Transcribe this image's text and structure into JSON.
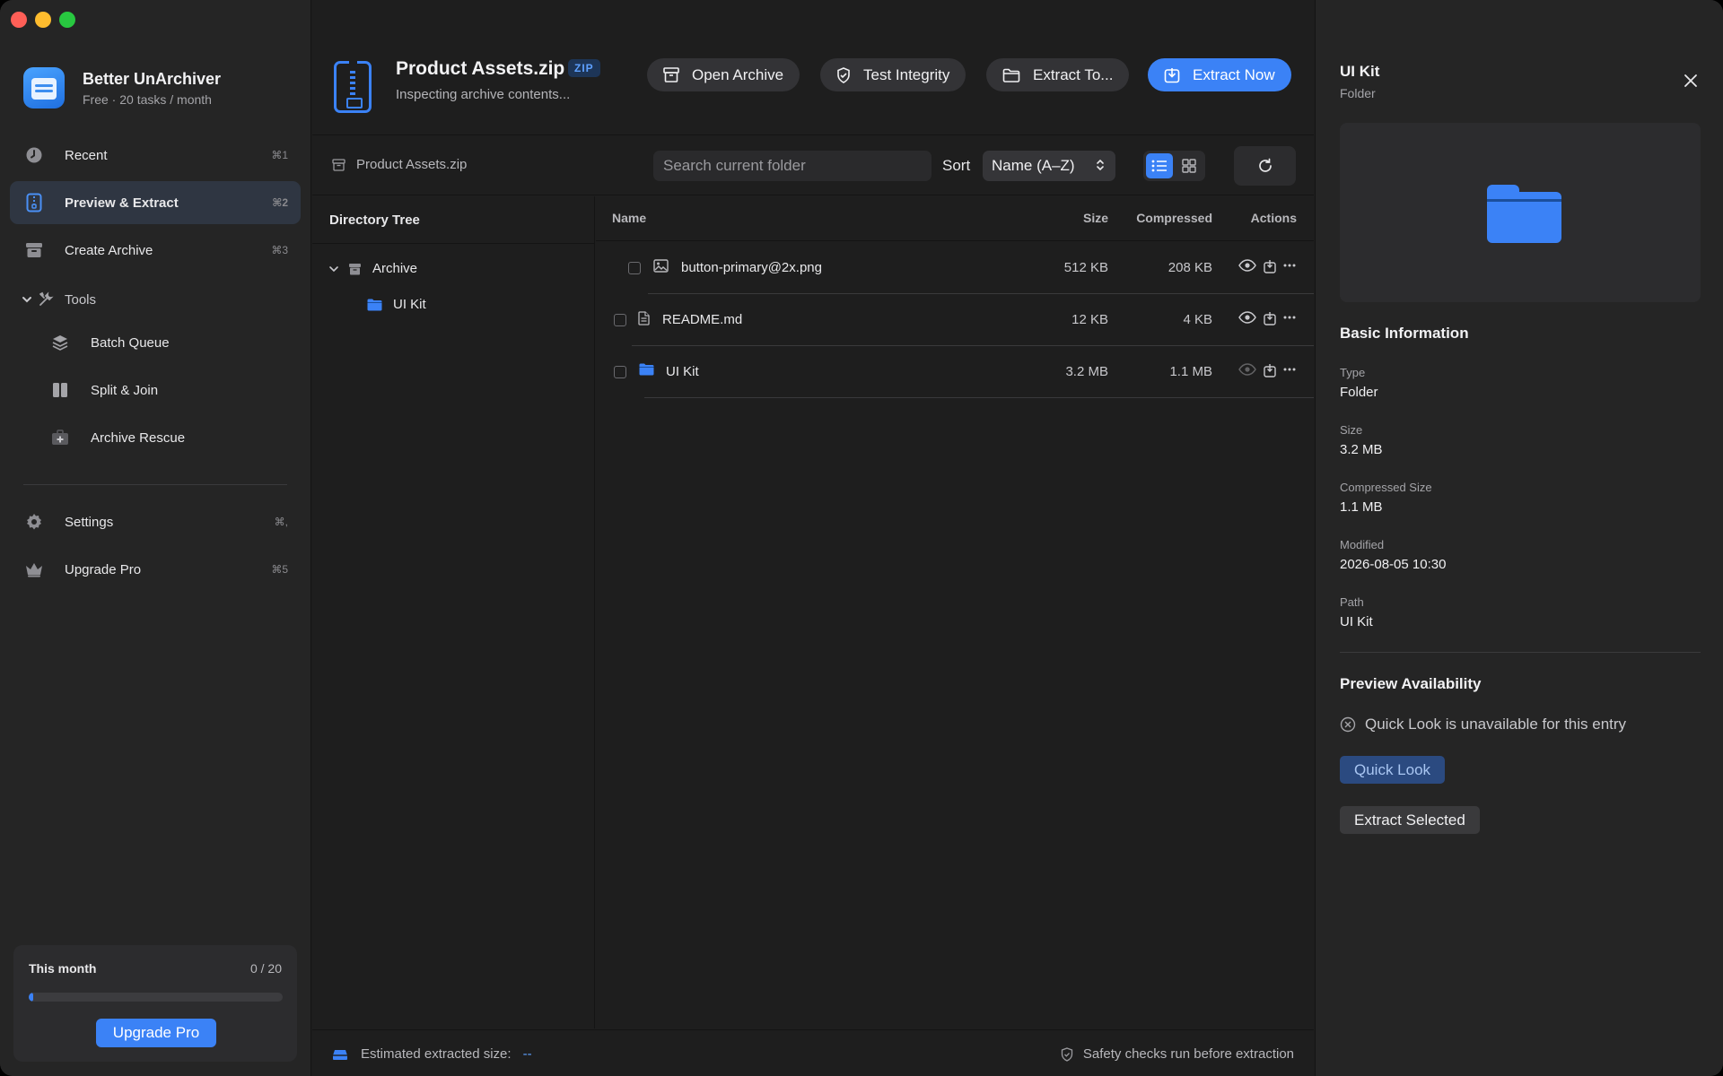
{
  "app": {
    "name": "Better UnArchiver",
    "plan": "Free · 20 tasks / month"
  },
  "sidebar": {
    "items": [
      {
        "label": "Recent",
        "shortcut": "⌘1",
        "icon": "clock-icon"
      },
      {
        "label": "Preview & Extract",
        "shortcut": "⌘2",
        "icon": "zip-file-icon",
        "active": true
      },
      {
        "label": "Create Archive",
        "shortcut": "⌘3",
        "icon": "archive-box-icon"
      }
    ],
    "tools_label": "Tools",
    "tools": [
      {
        "label": "Batch Queue",
        "icon": "layers-icon"
      },
      {
        "label": "Split & Join",
        "icon": "split-icon"
      },
      {
        "label": "Archive Rescue",
        "icon": "rescue-kit-icon"
      }
    ],
    "bottom_items": [
      {
        "label": "Settings",
        "shortcut": "⌘,",
        "icon": "gear-icon"
      },
      {
        "label": "Upgrade Pro",
        "shortcut": "⌘5",
        "icon": "crown-icon"
      }
    ],
    "usage": {
      "title": "This month",
      "count_text": "0 / 20",
      "used": 0,
      "limit": 20,
      "button": "Upgrade Pro"
    }
  },
  "header": {
    "file_name": "Product Assets.zip",
    "badge": "ZIP",
    "status": "Inspecting archive contents...",
    "buttons": {
      "open": "Open Archive",
      "test": "Test Integrity",
      "extract_to": "Extract To...",
      "extract_now": "Extract Now"
    }
  },
  "toolbar": {
    "breadcrumb": "Product Assets.zip",
    "search_placeholder": "Search current folder",
    "sort_label": "Sort",
    "sort_value": "Name (A–Z)",
    "view_mode": "list"
  },
  "tree": {
    "title": "Directory Tree",
    "root": "Archive",
    "children": [
      "UI Kit"
    ]
  },
  "table": {
    "headers": {
      "name": "Name",
      "size": "Size",
      "compressed": "Compressed",
      "actions": "Actions"
    },
    "rows": [
      {
        "name": "button-primary@2x.png",
        "size": "512 KB",
        "compressed": "208 KB",
        "type": "image"
      },
      {
        "name": "README.md",
        "size": "12 KB",
        "compressed": "4 KB",
        "type": "document"
      },
      {
        "name": "UI Kit",
        "size": "3.2 MB",
        "compressed": "1.1 MB",
        "type": "folder"
      }
    ]
  },
  "statusbar": {
    "estimated_label": "Estimated extracted size:",
    "estimated_value": "--",
    "safety": "Safety checks run before extraction"
  },
  "inspector": {
    "title": "UI Kit",
    "subtitle": "Folder",
    "basic_title": "Basic Information",
    "fields": [
      {
        "label": "Type",
        "value": "Folder"
      },
      {
        "label": "Size",
        "value": "3.2 MB"
      },
      {
        "label": "Compressed Size",
        "value": "1.1 MB"
      },
      {
        "label": "Modified",
        "value": "2026-08-05 10:30"
      },
      {
        "label": "Path",
        "value": "UI Kit"
      }
    ],
    "preview_title": "Preview Availability",
    "preview_note": "Quick Look is unavailable for this entry",
    "quick_look": "Quick Look",
    "extract_selected": "Extract Selected"
  },
  "colors": {
    "accent": "#3b82f6",
    "background": "#1e1e1e",
    "sidebar": "#252525"
  }
}
